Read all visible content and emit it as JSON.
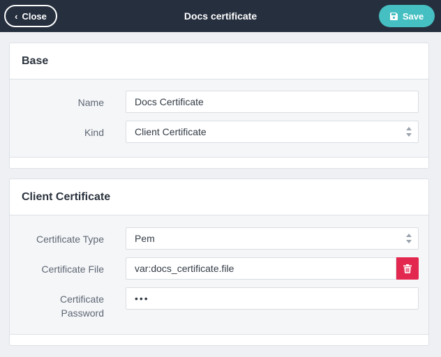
{
  "topbar": {
    "title": "Docs certificate",
    "close_label": "Close",
    "save_label": "Save"
  },
  "base": {
    "heading": "Base",
    "name_label": "Name",
    "name_value": "Docs Certificate",
    "kind_label": "Kind",
    "kind_value": "Client Certificate"
  },
  "client_certificate": {
    "heading": "Client Certificate",
    "type_label": "Certificate Type",
    "type_value": "Pem",
    "file_label": "Certificate File",
    "file_value": "var:docs_certificate.file",
    "password_label_line1": "Certificate",
    "password_label_line2": "Password",
    "password_value": "•••"
  },
  "colors": {
    "topbar_bg": "#262f3e",
    "save_accent": "#45bfc1",
    "delete_red": "#e3284f",
    "page_bg": "#eef0f3"
  },
  "icons": {
    "close": "chevron-left-icon",
    "save": "floppy-disk-icon",
    "select": "select-arrows-icon",
    "delete": "trash-icon"
  }
}
